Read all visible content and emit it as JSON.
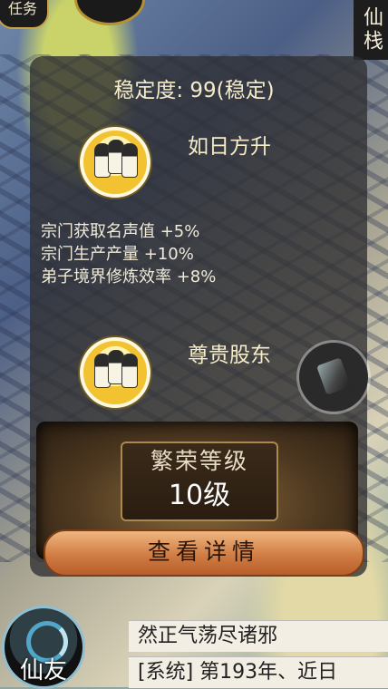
{
  "hud": {
    "task_label": "任务",
    "right_tab_label": "仙栈"
  },
  "panel": {
    "stability_text": "稳定度: 99(稳定)",
    "current_status": {
      "title": "如日方升",
      "effects": [
        "宗门获取名声值 +5%",
        "宗门生产产量 +10%",
        "弟子境界修炼效率 +8%"
      ]
    },
    "next_status": {
      "title": "尊贵股东"
    },
    "prosperity": {
      "label": "繁荣等级",
      "value": "10级"
    },
    "detail_button_label": "查看详情"
  },
  "bottom": {
    "friend_label": "仙友",
    "chat_lines": [
      "然正气荡尽诸邪",
      "[系统] 第193年、近日"
    ]
  }
}
